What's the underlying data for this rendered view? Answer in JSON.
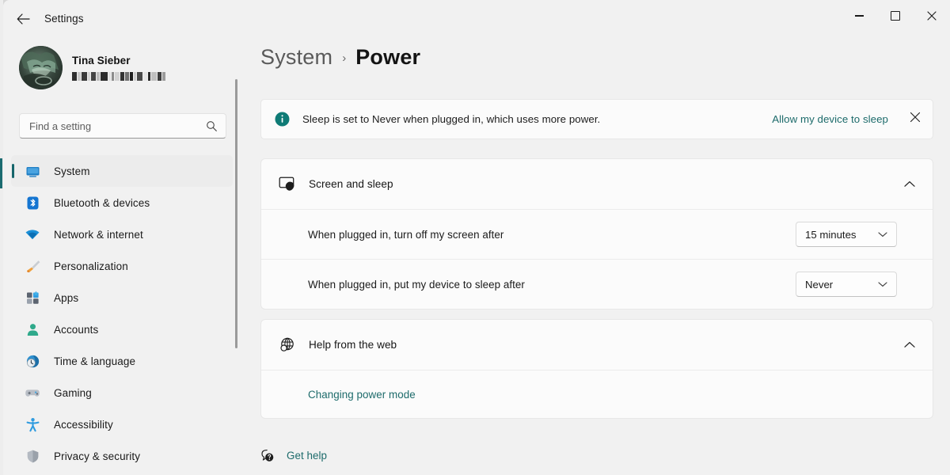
{
  "window": {
    "app_title": "Settings",
    "back_icon": "back-arrow-icon",
    "minimize_label": "",
    "maximize_label": "",
    "close_label": ""
  },
  "sidebar": {
    "profile": {
      "name": "Tina Sieber",
      "email_redacted": true,
      "avatar_icon": "user-avatar-cat-photo"
    },
    "search": {
      "placeholder": "Find a setting",
      "value": "",
      "icon": "search-icon"
    },
    "items": [
      {
        "label": "System",
        "icon": "monitor-icon",
        "selected": true
      },
      {
        "label": "Bluetooth & devices",
        "icon": "bluetooth-icon",
        "selected": false
      },
      {
        "label": "Network & internet",
        "icon": "wifi-icon",
        "selected": false
      },
      {
        "label": "Personalization",
        "icon": "paintbrush-icon",
        "selected": false
      },
      {
        "label": "Apps",
        "icon": "apps-grid-icon",
        "selected": false
      },
      {
        "label": "Accounts",
        "icon": "person-icon",
        "selected": false
      },
      {
        "label": "Time & language",
        "icon": "clock-globe-icon",
        "selected": false
      },
      {
        "label": "Gaming",
        "icon": "gamepad-icon",
        "selected": false
      },
      {
        "label": "Accessibility",
        "icon": "accessibility-icon",
        "selected": false
      },
      {
        "label": "Privacy & security",
        "icon": "shield-icon",
        "selected": false
      }
    ]
  },
  "main": {
    "breadcrumb": {
      "parent": "System",
      "separator": "›",
      "current": "Power"
    },
    "banner": {
      "icon": "info-circle-icon",
      "message": "Sleep is set to Never when plugged in, which uses more power.",
      "action_label": "Allow my device to sleep",
      "close_icon": "close-icon"
    },
    "sections": [
      {
        "id": "screen-and-sleep",
        "title": "Screen and sleep",
        "icon": "screen-sleep-icon",
        "expanded": true,
        "chevron_icon": "chevron-up-icon",
        "rows": [
          {
            "label": "When plugged in, turn off my screen after",
            "value": "15 minutes",
            "chevron_icon": "chevron-down-icon"
          },
          {
            "label": "When plugged in, put my device to sleep after",
            "value": "Never",
            "chevron_icon": "chevron-down-icon"
          }
        ]
      },
      {
        "id": "help-from-the-web",
        "title": "Help from the web",
        "icon": "globe-icon",
        "expanded": true,
        "chevron_icon": "chevron-up-icon",
        "links": [
          {
            "label": "Changing power mode"
          }
        ]
      }
    ],
    "get_help": {
      "label": "Get help",
      "icon": "help-question-icon"
    }
  },
  "colors": {
    "page_background": "#f1f1f1",
    "card_background": "#fbfbfb",
    "accent_teal": "#1d6b6b",
    "selection_pill": "#15656b",
    "info_icon": "#0f7b76",
    "text_primary": "#1a1a1a",
    "text_secondary": "#5a5a5a"
  }
}
